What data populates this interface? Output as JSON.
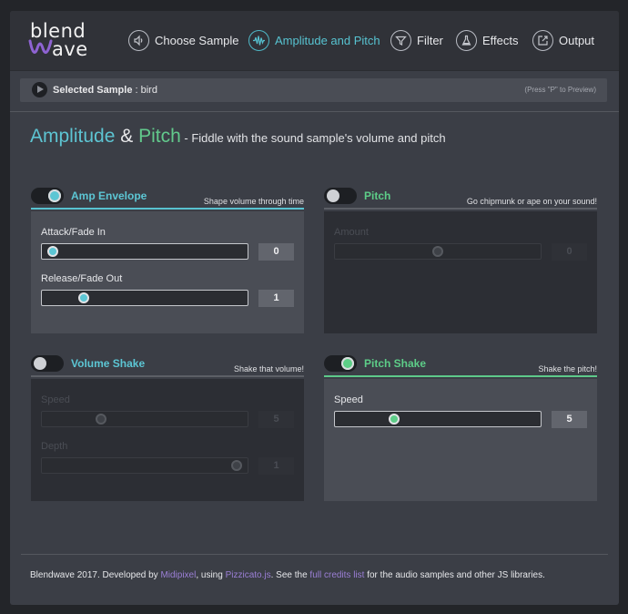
{
  "logo": {
    "line1": "blend",
    "line2": "ave"
  },
  "nav": [
    {
      "label": "Choose Sample",
      "icon": "speaker-icon"
    },
    {
      "label": "Amplitude and Pitch",
      "icon": "waveform-icon",
      "active": true
    },
    {
      "label": "Filter",
      "icon": "funnel-icon"
    },
    {
      "label": "Effects",
      "icon": "flask-icon"
    },
    {
      "label": "Output",
      "icon": "export-icon"
    }
  ],
  "selected": {
    "label": "Selected Sample",
    "sep": " : ",
    "value": "bird",
    "hint": "(Press \"P\" to Preview)"
  },
  "page": {
    "title_a": "Amplitude",
    "title_and": " & ",
    "title_b": "Pitch",
    "description": " - Fiddle with the sound sample's volume and pitch"
  },
  "colors": {
    "accent_blue": "#5cc6d4",
    "accent_green": "#5dcd88",
    "link_purple": "#9b7fd6",
    "panel_bg": "#4a4d55"
  },
  "panels": {
    "amp_envelope": {
      "name": "Amp Envelope",
      "subtitle": "Shape volume through time",
      "enabled": true,
      "controls": [
        {
          "label": "Attack/Fade In",
          "value": "0",
          "fraction": 0.02
        },
        {
          "label": "Release/Fade Out",
          "value": "1",
          "fraction": 0.18
        }
      ]
    },
    "pitch": {
      "name": "Pitch",
      "subtitle": "Go chipmunk or ape on your sound!",
      "enabled": false,
      "controls": [
        {
          "label": "Amount",
          "value": "0",
          "fraction": 0.5
        }
      ]
    },
    "volume_shake": {
      "name": "Volume Shake",
      "subtitle": "Shake that volume!",
      "enabled": false,
      "controls": [
        {
          "label": "Speed",
          "value": "5",
          "fraction": 0.27
        },
        {
          "label": "Depth",
          "value": "1",
          "fraction": 0.98
        }
      ]
    },
    "pitch_shake": {
      "name": "Pitch Shake",
      "subtitle": "Shake the pitch!",
      "enabled": true,
      "controls": [
        {
          "label": "Speed",
          "value": "5",
          "fraction": 0.27
        }
      ]
    }
  },
  "footer": {
    "t1": "Blendwave 2017. Developed by ",
    "l1": "Midipixel",
    "t2": ", using ",
    "l2": "Pizzicato.js",
    "t3": ". See the ",
    "l3": "full credits list",
    "t4": " for the audio samples and other JS libraries."
  }
}
